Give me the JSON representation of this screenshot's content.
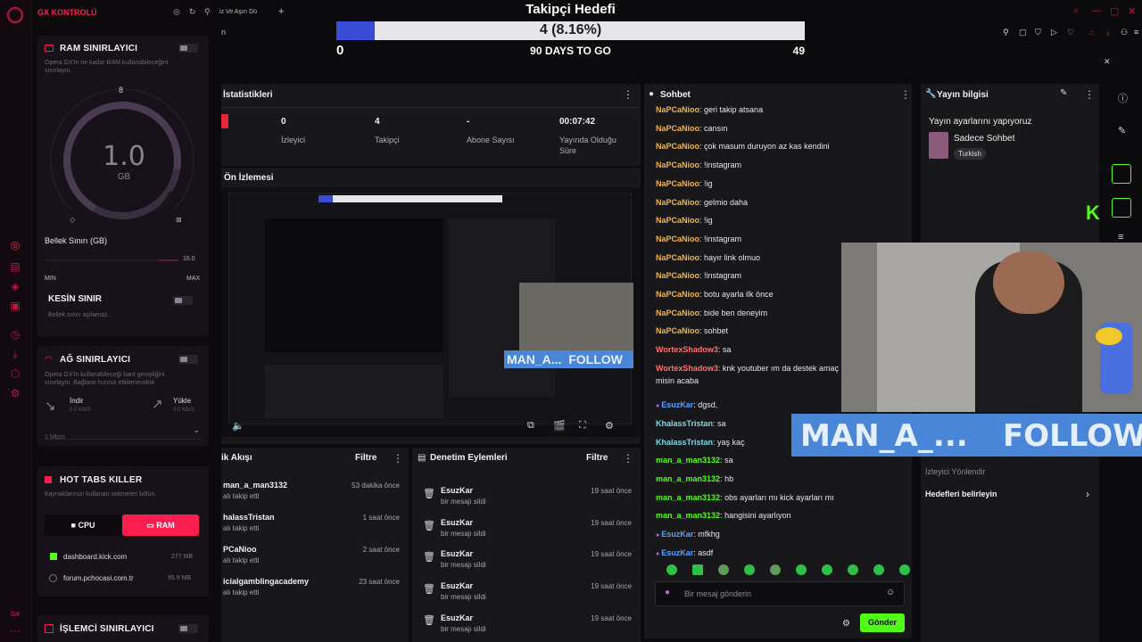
{
  "colors": {
    "gx_red": "#fa1e4e",
    "kick_green": "#53fc18",
    "panel": "#18181b",
    "progress_fill": "#3a4bd8"
  },
  "gx": {
    "brand": "GX KONTROLÜ",
    "tab_fragment": "iz Ve Aşırı Dü",
    "ram": {
      "title": "RAM SINIRLAYICI",
      "desc": "Opera GX'in ne kadar RAM kullanabileceğini sınırlayın.",
      "gauge_value": "1.0",
      "gauge_unit": "GB",
      "gauge_top": "8",
      "limit_label": "Bellek Sınırı (GB)",
      "max_value": "16.0",
      "min_label": "MIN",
      "max_label": "MAX",
      "hard_limit_title": "KESİN SINIR",
      "hard_limit_desc": "Bellek sınırı aşılamaz."
    },
    "network": {
      "title": "AĞ SINIRLAYICI",
      "desc": "Opera GX'in kullanabileceği bant genişliğini sınırlayın. Bağlantı hızınız etkilenecektir.",
      "download_label": "İndir",
      "download_speed": "0.0 KB/S",
      "upload_label": "Yükle",
      "upload_speed": "0.0 KB/S",
      "speed_select": "1 Mbps"
    },
    "hotTabs": {
      "title": "HOT TABS KILLER",
      "desc": "Kaynaklarınızı kullanan sekmeleri bölün.",
      "cpu_label": "CPU",
      "ram_label": "RAM",
      "tabs": [
        {
          "name": "dashboard.kick.com",
          "size": "277 MB"
        },
        {
          "name": "forum.pchocasi.com.tr",
          "size": "85.9 MB"
        }
      ]
    },
    "cpu": {
      "title": "İŞLEMCİ SINIRLAYICI"
    },
    "bottom_logo": "GX"
  },
  "goal": {
    "title": "Takipçi Hedefi",
    "progress_text": "4 (8.16%)",
    "progress_fraction": 0.0816,
    "start": "0",
    "days_left": "90 DAYS TO GO",
    "target": "49"
  },
  "stats": {
    "title": "İstatistikleri",
    "items": [
      {
        "value": "0",
        "label": "İzleyici"
      },
      {
        "value": "4",
        "label": "Takipçi"
      },
      {
        "value": "-",
        "label": "Abone Sayısı"
      },
      {
        "value": "00:07:42",
        "label": "Yayında Olduğu Süre"
      }
    ]
  },
  "preview": {
    "title": "Ön İzlemesi",
    "overlay_name": "MAN_A...",
    "overlay_follow": "FOLLOW"
  },
  "activity": {
    "title": "ik Akışı",
    "filter": "Filtre",
    "items": [
      {
        "name": "man_a_man3132",
        "sub": "alı takip etti",
        "time": "53 dakika önce"
      },
      {
        "name": "halassTristan",
        "sub": "alı takip etti",
        "time": "1 saat önce"
      },
      {
        "name": "PCaNioo",
        "sub": "alı takip etti",
        "time": "2 saat önce"
      },
      {
        "name": "icialgamblingacademy",
        "sub": "alı takip etti",
        "time": "23 saat önce"
      }
    ]
  },
  "moderation": {
    "title": "Denetim Eylemleri",
    "filter": "Filtre",
    "items": [
      {
        "name": "EsuzKar",
        "sub": "bir mesajı sildi",
        "time": "19 saat önce"
      },
      {
        "name": "EsuzKar",
        "sub": "bir mesajı sildi",
        "time": "19 saat önce"
      },
      {
        "name": "EsuzKar",
        "sub": "bir mesajı sildi",
        "time": "19 saat önce"
      },
      {
        "name": "EsuzKar",
        "sub": "bir mesajı sildi",
        "time": "19 saat önce"
      },
      {
        "name": "EsuzKar",
        "sub": "bir mesajı sildi",
        "time": "19 saat önce"
      }
    ]
  },
  "chat": {
    "title": "Sohbet",
    "messages": [
      {
        "user": "NaPCaNioo",
        "text": "geri takip atsana",
        "color": "#f5b342"
      },
      {
        "user": "NaPCaNioo",
        "text": "cansın",
        "color": "#f5b342"
      },
      {
        "user": "NaPCaNioo",
        "text": "çok masum duruyon az kas kendini",
        "color": "#f5b342"
      },
      {
        "user": "NaPCaNioo",
        "text": "!instagram",
        "color": "#f5b342"
      },
      {
        "user": "NaPCaNioo",
        "text": "!ig",
        "color": "#f5b342"
      },
      {
        "user": "NaPCaNioo",
        "text": "gelmio daha",
        "color": "#f5b342"
      },
      {
        "user": "NaPCaNioo",
        "text": "!ig",
        "color": "#f5b342"
      },
      {
        "user": "NaPCaNioo",
        "text": "!instagram",
        "color": "#f5b342"
      },
      {
        "user": "NaPCaNioo",
        "text": "hayır link olmuo",
        "color": "#f5b342"
      },
      {
        "user": "NaPCaNioo",
        "text": "!instagram",
        "color": "#f5b342"
      },
      {
        "user": "NaPCaNioo",
        "text": "botu ayarla ilk önce",
        "color": "#f5b342"
      },
      {
        "user": "NaPCaNioo",
        "text": "bide ben deneyim",
        "color": "#f5b342"
      },
      {
        "user": "NaPCaNioo",
        "text": "sohbet",
        "color": "#f5b342"
      },
      {
        "user": "WortexShadow3",
        "text": "sa",
        "color": "#ff6f6f"
      },
      {
        "user": "WortexShadow3",
        "text": "knk youtuber ım da destek amaç",
        "color": "#ff6f6f"
      },
      {
        "user": "",
        "text": "misin acaba",
        "color": "#ff6f6f"
      },
      {
        "user": "EsuzKar",
        "text": "dgsd,",
        "color": "#5aa2ff"
      },
      {
        "user": "KhalassTristan",
        "text": "sa",
        "color": "#7ad8e8"
      },
      {
        "user": "KhalassTristan",
        "text": "yaş kaç",
        "color": "#7ad8e8"
      },
      {
        "user": "man_a_man3132",
        "text": "sa",
        "color": "#53fc18"
      },
      {
        "user": "man_a_man3132",
        "text": "hb",
        "color": "#53fc18"
      },
      {
        "user": "man_a_man3132",
        "text": "obs ayarları mı kick ayarları mı",
        "color": "#53fc18"
      },
      {
        "user": "man_a_man3132",
        "text": "hangisini ayarlıyon",
        "color": "#53fc18"
      },
      {
        "user": "EsuzKar",
        "text": "mfkhg",
        "color": "#5aa2ff"
      },
      {
        "user": "EsuzKar",
        "text": "asdf",
        "color": "#5aa2ff"
      }
    ],
    "placeholder": "Bir mesaj gönderin",
    "send_label": "Gönder"
  },
  "streamInfo": {
    "title": "Yayın bilgisi",
    "stream_title": "Yayın ayarlarını yapıyoruz",
    "category": "Sadece Sohbet",
    "language": "Turkish",
    "redirect_label": "İzleyici Yönlendir",
    "goals_label": "Hedefleri belirleyin"
  },
  "webcam_overlay": {
    "name": "MAN_A_...",
    "follow": "FOLLOW"
  }
}
